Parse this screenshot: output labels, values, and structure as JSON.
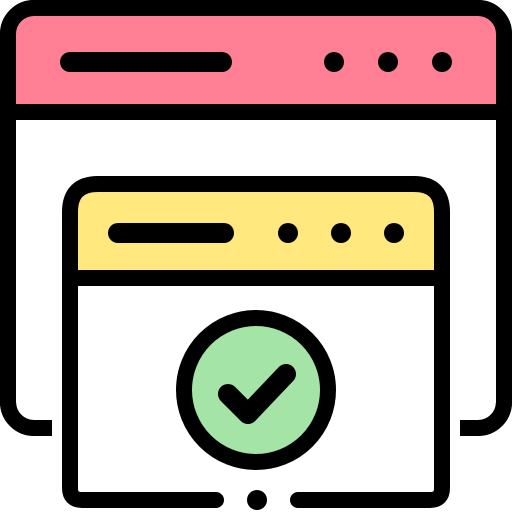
{
  "icon": {
    "name": "browser-windows-checkmark-icon",
    "colors": {
      "outline": "#000000",
      "back_window_header": "#FF8095",
      "front_window_header": "#FFE97E",
      "window_body": "#FFFFFF",
      "check_circle": "#A4E4A6"
    },
    "back_window": {
      "header_dots": 3
    },
    "front_window": {
      "header_dots": 3
    }
  }
}
